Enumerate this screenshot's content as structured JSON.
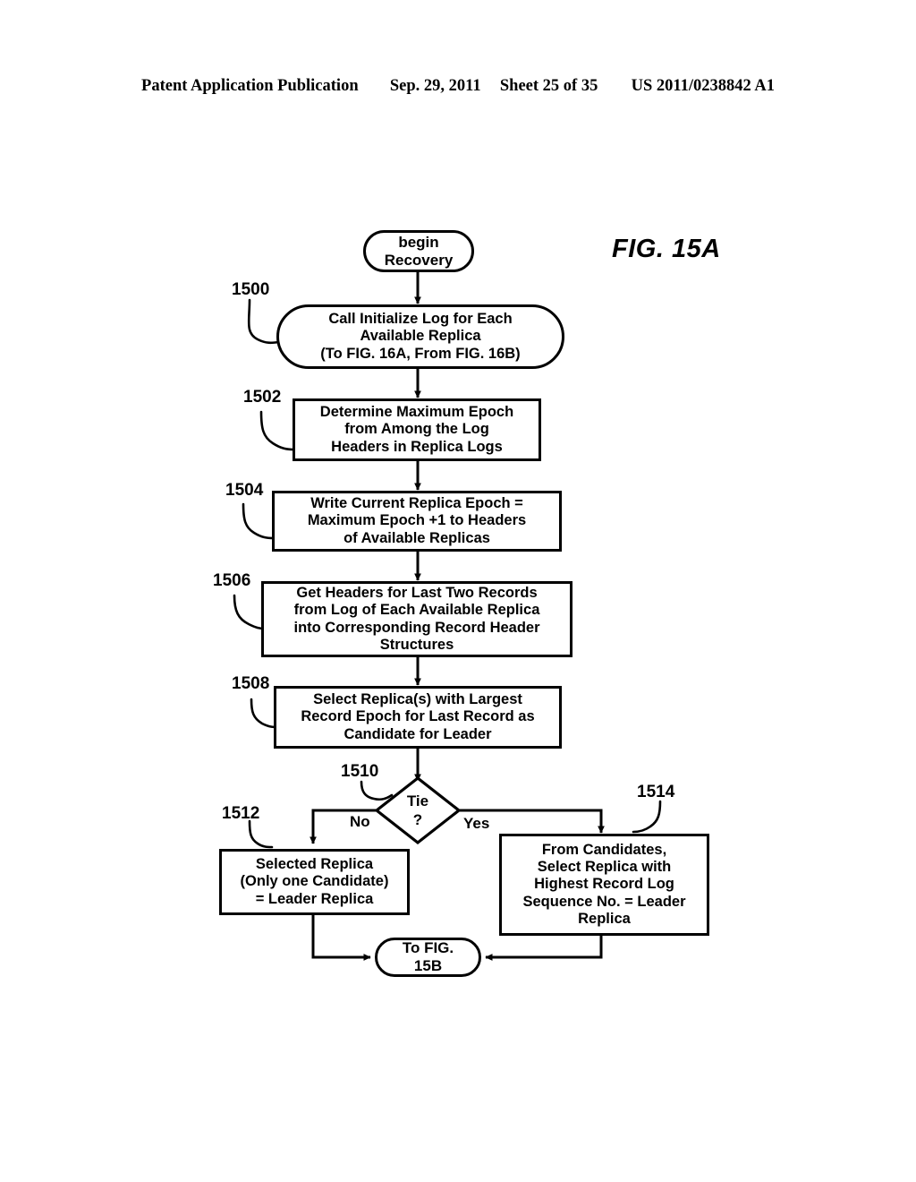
{
  "header": {
    "publication": "Patent Application Publication",
    "date": "Sep. 29, 2011",
    "sheet": "Sheet 25 of 35",
    "patent_number": "US 2011/0238842 A1"
  },
  "figure": {
    "title": "FIG. 15A"
  },
  "flowchart": {
    "start": {
      "id": "begin-recovery",
      "line1": "begin",
      "line2": "Recovery"
    },
    "steps": [
      {
        "ref": "1500",
        "shape": "rounded-process",
        "line1": "Call Initialize Log for Each",
        "line2": "Available Replica",
        "line3": "(To FIG. 16A, From FIG. 16B)"
      },
      {
        "ref": "1502",
        "shape": "process",
        "line1": "Determine Maximum Epoch",
        "line2": "from Among the Log",
        "line3": "Headers in Replica Logs"
      },
      {
        "ref": "1504",
        "shape": "process",
        "line1": "Write Current Replica Epoch =",
        "line2": "Maximum Epoch +1 to Headers",
        "line3": "of Available Replicas"
      },
      {
        "ref": "1506",
        "shape": "process",
        "line1": "Get Headers for Last Two Records",
        "line2": "from Log of Each Available Replica",
        "line3": "into Corresponding Record Header",
        "line4": "Structures"
      },
      {
        "ref": "1508",
        "shape": "process",
        "line1": "Select Replica(s) with Largest",
        "line2": "Record Epoch for Last Record as",
        "line3": "Candidate for Leader"
      }
    ],
    "decision": {
      "ref": "1510",
      "shape": "decision",
      "line1": "Tie",
      "line2": "?",
      "branch_no": "No",
      "branch_yes": "Yes"
    },
    "no_branch_box": {
      "ref": "1512",
      "shape": "process",
      "line1": "Selected Replica",
      "line2": "(Only one Candidate)",
      "line3": "= Leader Replica"
    },
    "yes_branch_box": {
      "ref": "1514",
      "shape": "process",
      "line1": "From Candidates,",
      "line2": "Select Replica with",
      "line3": "Highest Record Log",
      "line4": "Sequence No. = Leader",
      "line5": "Replica"
    },
    "end": {
      "id": "to-fig-15b",
      "line1": "To FIG.",
      "line2": "15B"
    }
  },
  "colors": {
    "ink": "#000000",
    "paper": "#ffffff"
  }
}
